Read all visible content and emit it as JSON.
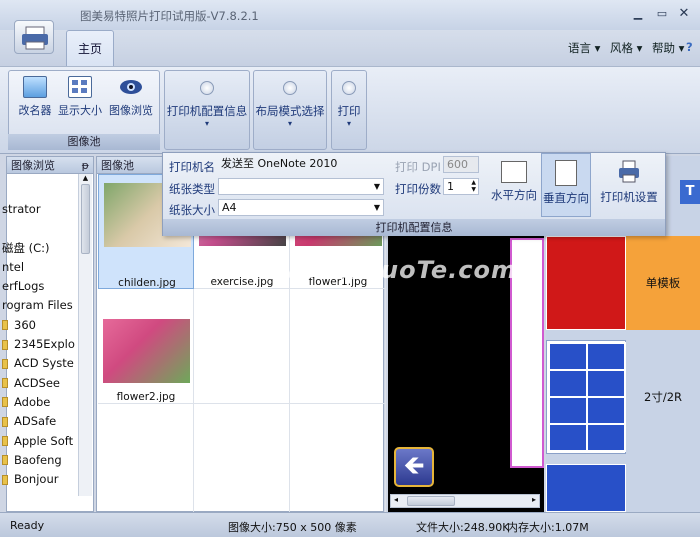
{
  "app": {
    "title": "图美易特照片打印试用版-V7.8.2.1"
  },
  "tabs": {
    "main": "主页"
  },
  "menu": {
    "language": "语言",
    "style": "风格",
    "help": "帮助"
  },
  "ribbon": {
    "rename": "改名器",
    "display_size": "显示大小",
    "image_browse": "图像浏览",
    "group_caption": "图像池",
    "printer_config": "打印机配置信息",
    "layout_mode": "布局模式选择",
    "print": "打印"
  },
  "left_panel": {
    "title": "图像浏览",
    "items": [
      "strator",
      "",
      "磁盘 (C:)",
      "ntel",
      "erfLogs",
      "rogram Files",
      "360",
      "2345Explo",
      "ACD Syste",
      "ACDSee",
      "Adobe",
      "ADSafe",
      "Apple Soft",
      "Baofeng",
      "Bonjour"
    ]
  },
  "image_pool": {
    "title": "图像池",
    "images": [
      "childen.jpg",
      "exercise.jpg",
      "flower1.jpg",
      "flower2.jpg"
    ]
  },
  "printer_popup": {
    "printer_name_label": "打印机名",
    "printer_name_value": "发送至 OneNote 2010",
    "paper_type_label": "纸张类型",
    "paper_type_value": "",
    "paper_size_label": "纸张大小",
    "paper_size_value": "A4",
    "dpi_label": "打印 DPI",
    "dpi_value": "600",
    "copies_label": "打印份数",
    "copies_value": "1",
    "horizontal": "水平方向",
    "vertical": "垂直方向",
    "printer_settings": "打印机设置",
    "caption": "打印机配置信息"
  },
  "templates": {
    "single": "单模板",
    "two_inch": "2寸/2R"
  },
  "status": {
    "ready": "Ready",
    "image_size": "图像大小:750 x 500 像素",
    "file_size": "文件大小:248.90K",
    "mem_size": "内存大小:1.07M"
  },
  "watermark": "www.DuoTe.com",
  "colors": {
    "accent": "#1f3a7a",
    "template_red": "#d01818",
    "template_blue": "#2850c8",
    "template_orange": "#f5a23a"
  }
}
